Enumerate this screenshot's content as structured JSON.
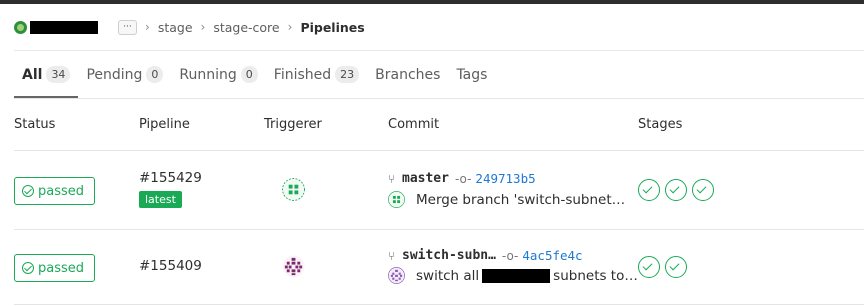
{
  "breadcrumb": {
    "ellipsis": "···",
    "items": [
      "stage",
      "stage-core"
    ],
    "current": "Pipelines",
    "separator": "›"
  },
  "tabs": [
    {
      "label": "All",
      "count": "34",
      "active": true
    },
    {
      "label": "Pending",
      "count": "0"
    },
    {
      "label": "Running",
      "count": "0"
    },
    {
      "label": "Finished",
      "count": "23"
    },
    {
      "label": "Branches"
    },
    {
      "label": "Tags"
    }
  ],
  "table": {
    "headers": [
      "Status",
      "Pipeline",
      "Triggerer",
      "Commit",
      "Stages"
    ],
    "rows": [
      {
        "status": "passed",
        "pipeline_id": "#155429",
        "latest_label": "latest",
        "ref": "master",
        "sha": "249713b5",
        "message": "Merge branch 'switch-subnet…",
        "stages": 3
      },
      {
        "status": "passed",
        "pipeline_id": "#155409",
        "ref": "switch-subn…",
        "sha": "4ac5fe4c",
        "message_before": "switch all",
        "message_after": "subnets to…",
        "stages": 2
      }
    ]
  },
  "colors": {
    "success": "#1aaa55",
    "link": "#1f78d1",
    "avatar_green": "#1aaa55",
    "avatar_purple": "#7b2a6b"
  }
}
